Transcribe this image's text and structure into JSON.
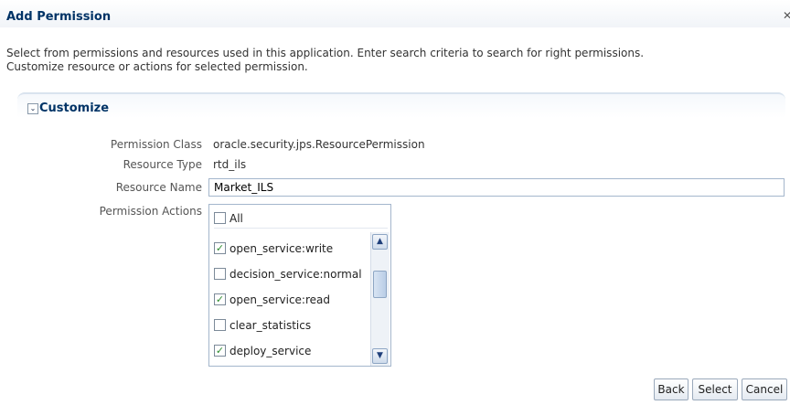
{
  "dialog": {
    "title": "Add Permission",
    "close_icon": "close-icon",
    "instructions_line1": "Select from permissions and resources used in this application. Enter search criteria to search for right permissions.",
    "instructions_line2": "Customize resource or actions for selected permission."
  },
  "customize": {
    "header": "Customize",
    "expanded": true,
    "fields": {
      "permission_class_label": "Permission Class",
      "permission_class_value": "oracle.security.jps.ResourcePermission",
      "resource_type_label": "Resource Type",
      "resource_type_value": "rtd_ils",
      "resource_name_label": "Resource Name",
      "resource_name_value": "Market_ILS",
      "permission_actions_label": "Permission Actions"
    },
    "actions": {
      "all_label": "All",
      "all_checked": false,
      "items": [
        {
          "label": "open_service:write",
          "checked": true
        },
        {
          "label": "decision_service:normal",
          "checked": false
        },
        {
          "label": "open_service:read",
          "checked": true
        },
        {
          "label": "clear_statistics",
          "checked": false
        },
        {
          "label": "deploy_service",
          "checked": true
        }
      ]
    }
  },
  "buttons": {
    "back": "Back",
    "select": "Select",
    "cancel": "Cancel"
  },
  "colors": {
    "title": "#003366",
    "check": "#2e8b2e",
    "border": "#a4b6cc"
  }
}
